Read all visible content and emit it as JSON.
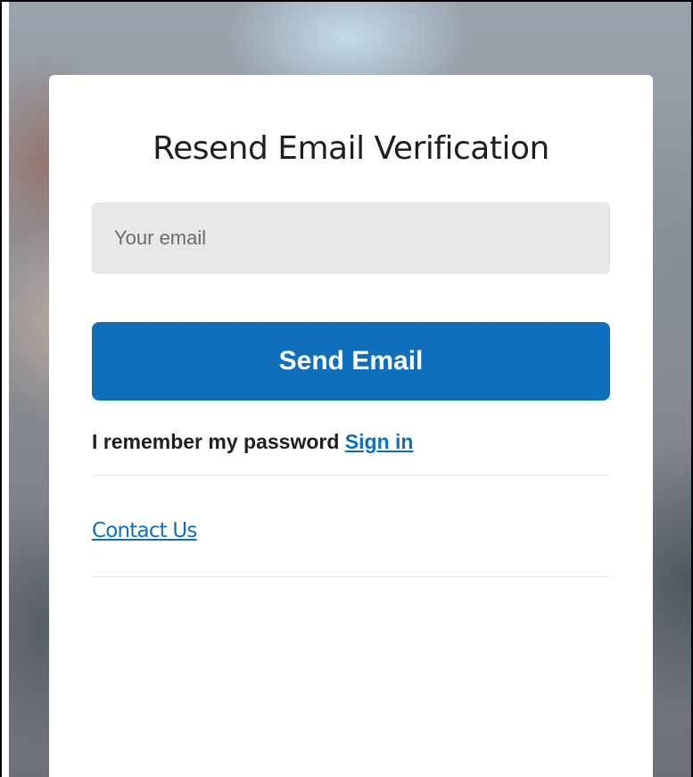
{
  "card": {
    "title": "Resend Email Verification",
    "email_field": {
      "placeholder": "Your email",
      "value": ""
    },
    "send_button_label": "Send Email",
    "remember_text": "I remember my password",
    "signin_link_label": "Sign in",
    "contact_link_label": "Contact Us"
  },
  "colors": {
    "accent": "#0f6fbd",
    "input_bg": "#e8e8e8",
    "card_bg": "#ffffff",
    "title_text": "#1f1f1f"
  }
}
